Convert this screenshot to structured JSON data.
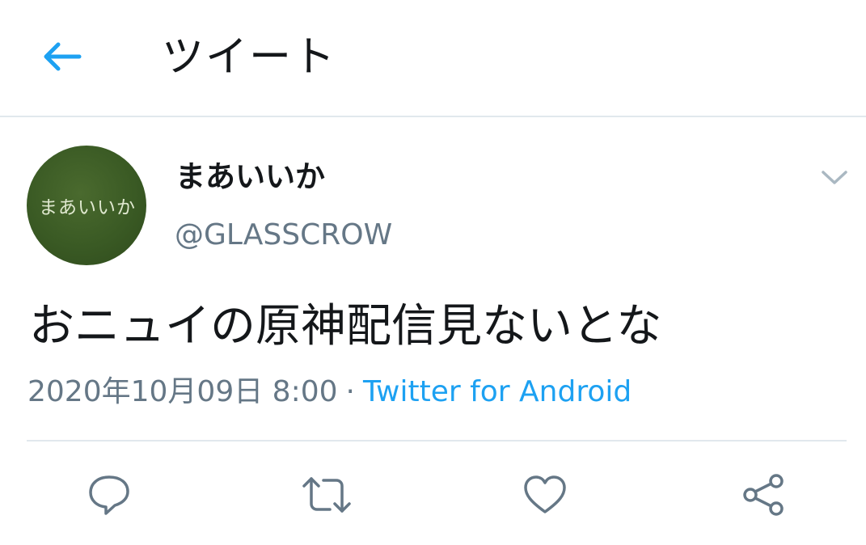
{
  "header": {
    "back_icon": "arrow-left-icon",
    "title": "ツイート"
  },
  "tweet": {
    "avatar_text": "まあいいか",
    "display_name": "まあいいか",
    "handle": "@GLASSCROW",
    "caret_icon": "chevron-down-icon",
    "text": "おニュイの原神配信見ないとな",
    "timestamp": "2020年10月09日 8:00",
    "separator": "·",
    "source": "Twitter for Android"
  },
  "actions": [
    {
      "icon": "reply-icon"
    },
    {
      "icon": "retweet-icon"
    },
    {
      "icon": "like-icon"
    },
    {
      "icon": "share-icon"
    }
  ],
  "colors": {
    "accent": "#1da1f2",
    "secondary_text": "#657786",
    "primary_text": "#14171a",
    "divider": "#e1e8ed",
    "icon": "#657786",
    "avatar_bg": "#3a5a24"
  }
}
